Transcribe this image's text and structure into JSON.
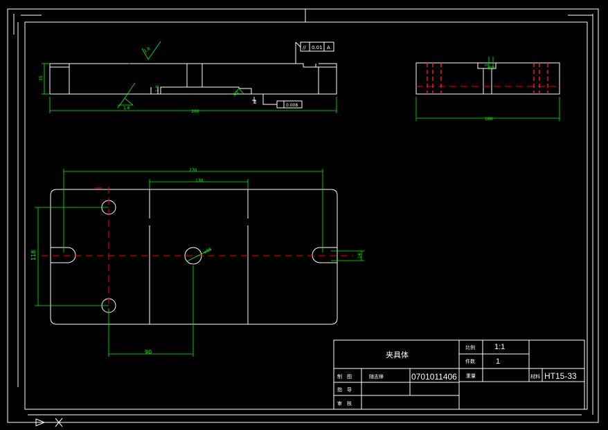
{
  "front_view": {
    "dim_height": "35",
    "dim_length": "300",
    "roughness_top": "1.6",
    "roughness_bottom": "1.6",
    "roughness_step": "1.6",
    "roughness_small": "3.2",
    "tol_parallel_symbol": "//",
    "tol_parallel_value": "0.01",
    "tol_parallel_datum": "A",
    "tol_flat_value": "0.008",
    "datum_mark": "B"
  },
  "side_view": {
    "dim_width": "160",
    "dim_slot": "5"
  },
  "top_view": {
    "dim_span": "270",
    "dim_center": "130",
    "dim_vertical": "118",
    "dim_offset": "90",
    "dim_hole": "⌀68",
    "dim_slot": "14"
  },
  "title_block": {
    "name": "夹具体",
    "scale_label": "比例",
    "scale_value": "1:1",
    "qty_label": "件数",
    "qty_value": "1",
    "draw_label": "制　图",
    "designer": "随志锋",
    "student_no": "0701011406",
    "weight_label": "重量",
    "material_label": "材料",
    "material": "HT15-33",
    "guide_label": "指　导",
    "review_label": "审　核"
  }
}
